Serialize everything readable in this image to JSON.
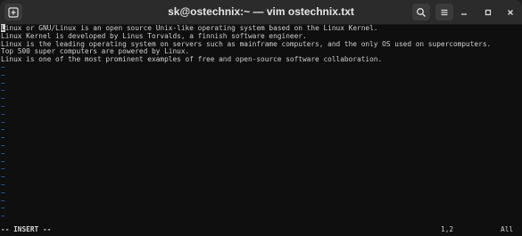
{
  "window": {
    "title": "sk@ostechnix:~ — vim ostechnix.txt",
    "icons": {
      "new_tab": "new-tab-icon",
      "search": "search-icon",
      "menu": "hamburger-menu-icon",
      "minimize": "minimize-icon",
      "maximize": "maximize-icon",
      "close": "close-icon"
    }
  },
  "editor": {
    "cursor_char": "L",
    "first_line_rest": "inux or GNU/Linux is an open source Unix-like operating system based on the Linux Kernel.",
    "lines": [
      "Linux Kernel is developed by Linus Torvalds, a finnish software engineer.",
      "Linux is the leading operating system on servers such as mainframe computers, and the only OS used on supercomputers.",
      "Top 500 super computers are powered by Linux.",
      "Linux is one of the most prominent examples of free and open-source software collaboration."
    ],
    "tilde": "~",
    "tilde_count": 20
  },
  "status": {
    "mode": "-- INSERT --",
    "position": "1,2",
    "scroll": "All"
  },
  "colors": {
    "background": "#0f0f0f",
    "text": "#d0d0d0",
    "tilde": "#3a6fd8",
    "titlebar": "#2b2b2b"
  }
}
